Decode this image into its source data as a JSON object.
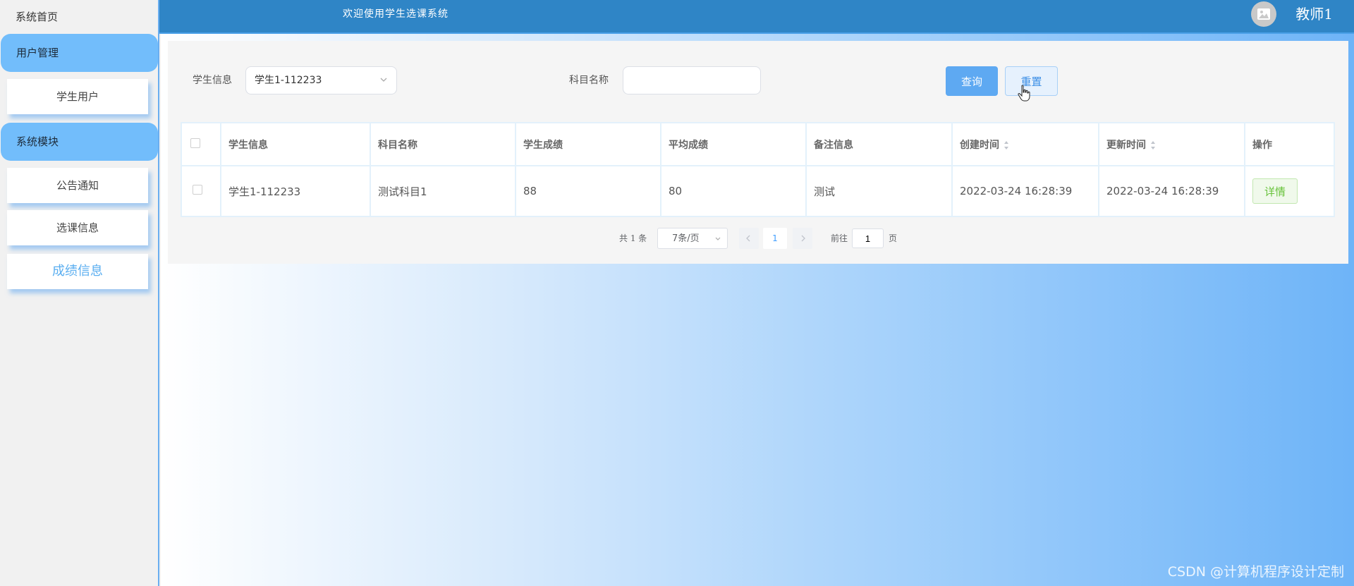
{
  "sidebar": {
    "home": "系统首页",
    "groups": [
      {
        "label": "用户管理",
        "items": [
          "学生用户"
        ]
      },
      {
        "label": "系统模块",
        "items": [
          "公告通知",
          "选课信息",
          "成绩信息"
        ]
      }
    ]
  },
  "header": {
    "title": "欢迎使用学生选课系统",
    "user": "教师1"
  },
  "search": {
    "student_label": "学生信息",
    "student_value": "学生1-112233",
    "subject_label": "科目名称",
    "subject_value": "",
    "query_button": "查询",
    "reset_button": "重置"
  },
  "table": {
    "columns": [
      "学生信息",
      "科目名称",
      "学生成绩",
      "平均成绩",
      "备注信息",
      "创建时间",
      "更新时间",
      "操作"
    ],
    "rows": [
      {
        "student": "学生1-112233",
        "subject": "测试科目1",
        "score": "88",
        "average": "80",
        "remark": "测试",
        "created": "2022-03-24 16:28:39",
        "updated": "2022-03-24 16:28:39",
        "action": "详情"
      }
    ]
  },
  "pagination": {
    "total": "共 1 条",
    "page_size": "7条/页",
    "current_page": "1",
    "goto_label": "前往",
    "goto_value": "1",
    "page_label": "页"
  },
  "watermark": "CSDN @计算机程序设计定制",
  "colors": {
    "header": "#2f85c6",
    "sidebar_group": "#72bdfb",
    "primary": "#5ea9f2",
    "success": "#67c23a"
  }
}
